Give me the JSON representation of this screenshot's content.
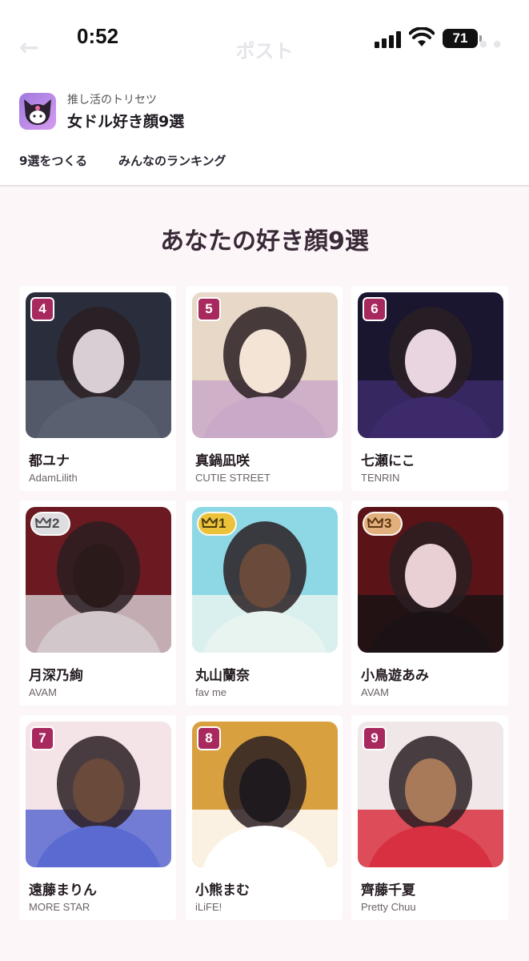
{
  "status_bar": {
    "time": "0:52",
    "battery": "71"
  },
  "nav": {
    "back_icon": "arrow-left-icon",
    "title": "ポスト",
    "more": "•••"
  },
  "app": {
    "subtitle": "推し活のトリセツ",
    "title": "女ドル好き顔9選",
    "icon": "app-mascot-icon"
  },
  "tabs": [
    {
      "label": "9選をつくる"
    },
    {
      "label": "みんなのランキング"
    }
  ],
  "section_title": "あなたの好き顔9選",
  "colors": {
    "badge_number": "#a8295e",
    "gold": "#ecc23a",
    "silver": "#dedee0",
    "bronze": "#e2b07c",
    "background": "#fcf6f8"
  },
  "cards": [
    {
      "badge": "4",
      "badge_type": "number",
      "name": "都ユナ",
      "group": "AdamLilith",
      "photo_colors": [
        "#2a2e3c",
        "#5a6070",
        "#d8cfd4"
      ]
    },
    {
      "badge": "5",
      "badge_type": "number",
      "name": "真鍋凪咲",
      "group": "CUTIE STREET",
      "photo_colors": [
        "#e8d8c8",
        "#c9a9c8",
        "#f3e4d6"
      ]
    },
    {
      "badge": "6",
      "badge_type": "number",
      "name": "七瀬にこ",
      "group": "TENRIN",
      "photo_colors": [
        "#1a1630",
        "#3c2a6a",
        "#e8d5e0"
      ]
    },
    {
      "badge": "2",
      "badge_type": "crown",
      "crown_color": "silver",
      "name": "月深乃絢",
      "group": "AVAM",
      "photo_colors": [
        "#6a1a20",
        "#d2c8cc",
        "#2a1a1a"
      ]
    },
    {
      "badge": "1",
      "badge_type": "crown",
      "crown_color": "gold",
      "name": "丸山蘭奈",
      "group": "fav me",
      "photo_colors": [
        "#8ed8e6",
        "#e8f4f0",
        "#6a4a3a"
      ]
    },
    {
      "badge": "3",
      "badge_type": "crown",
      "crown_color": "bronze",
      "name": "小鳥遊あみ",
      "group": "AVAM",
      "photo_colors": [
        "#5a1418",
        "#1a1214",
        "#e8d0d4"
      ]
    },
    {
      "badge": "7",
      "badge_type": "number",
      "name": "遠藤まりん",
      "group": "MORE STAR",
      "photo_colors": [
        "#f4e4e8",
        "#5a6ad0",
        "#6a4a3a"
      ]
    },
    {
      "badge": "8",
      "badge_type": "number",
      "name": "小熊まむ",
      "group": "iLiFE!",
      "photo_colors": [
        "#d9a040",
        "#ffffff",
        "#1e1a1e"
      ]
    },
    {
      "badge": "9",
      "badge_type": "number",
      "name": "齊藤千夏",
      "group": "Pretty Chuu",
      "photo_colors": [
        "#f0e8e8",
        "#d83040",
        "#a87a5a"
      ]
    }
  ]
}
